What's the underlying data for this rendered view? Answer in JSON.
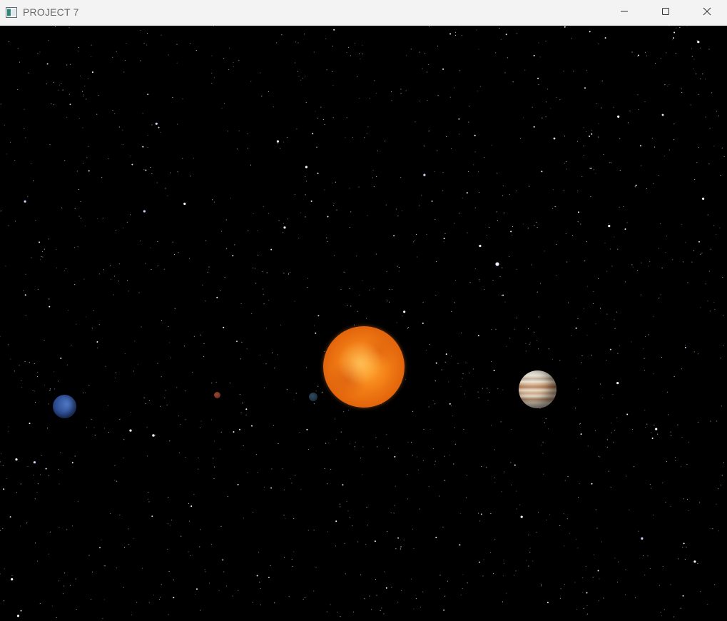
{
  "window": {
    "title": "PROJECT 7",
    "app_icon": "window-app-icon",
    "controls": {
      "minimize_icon": "minimize-icon",
      "maximize_icon": "maximize-icon",
      "close_icon": "close-icon"
    }
  },
  "scene": {
    "background_color": "#000000",
    "bodies": [
      {
        "name": "sun",
        "color": "#f07a14"
      },
      {
        "name": "jupiter",
        "color": "#c7976b"
      },
      {
        "name": "neptune",
        "color": "#2f4f96"
      },
      {
        "name": "mars",
        "color": "#7a3420"
      },
      {
        "name": "earth",
        "color": "#1f3344"
      }
    ]
  }
}
